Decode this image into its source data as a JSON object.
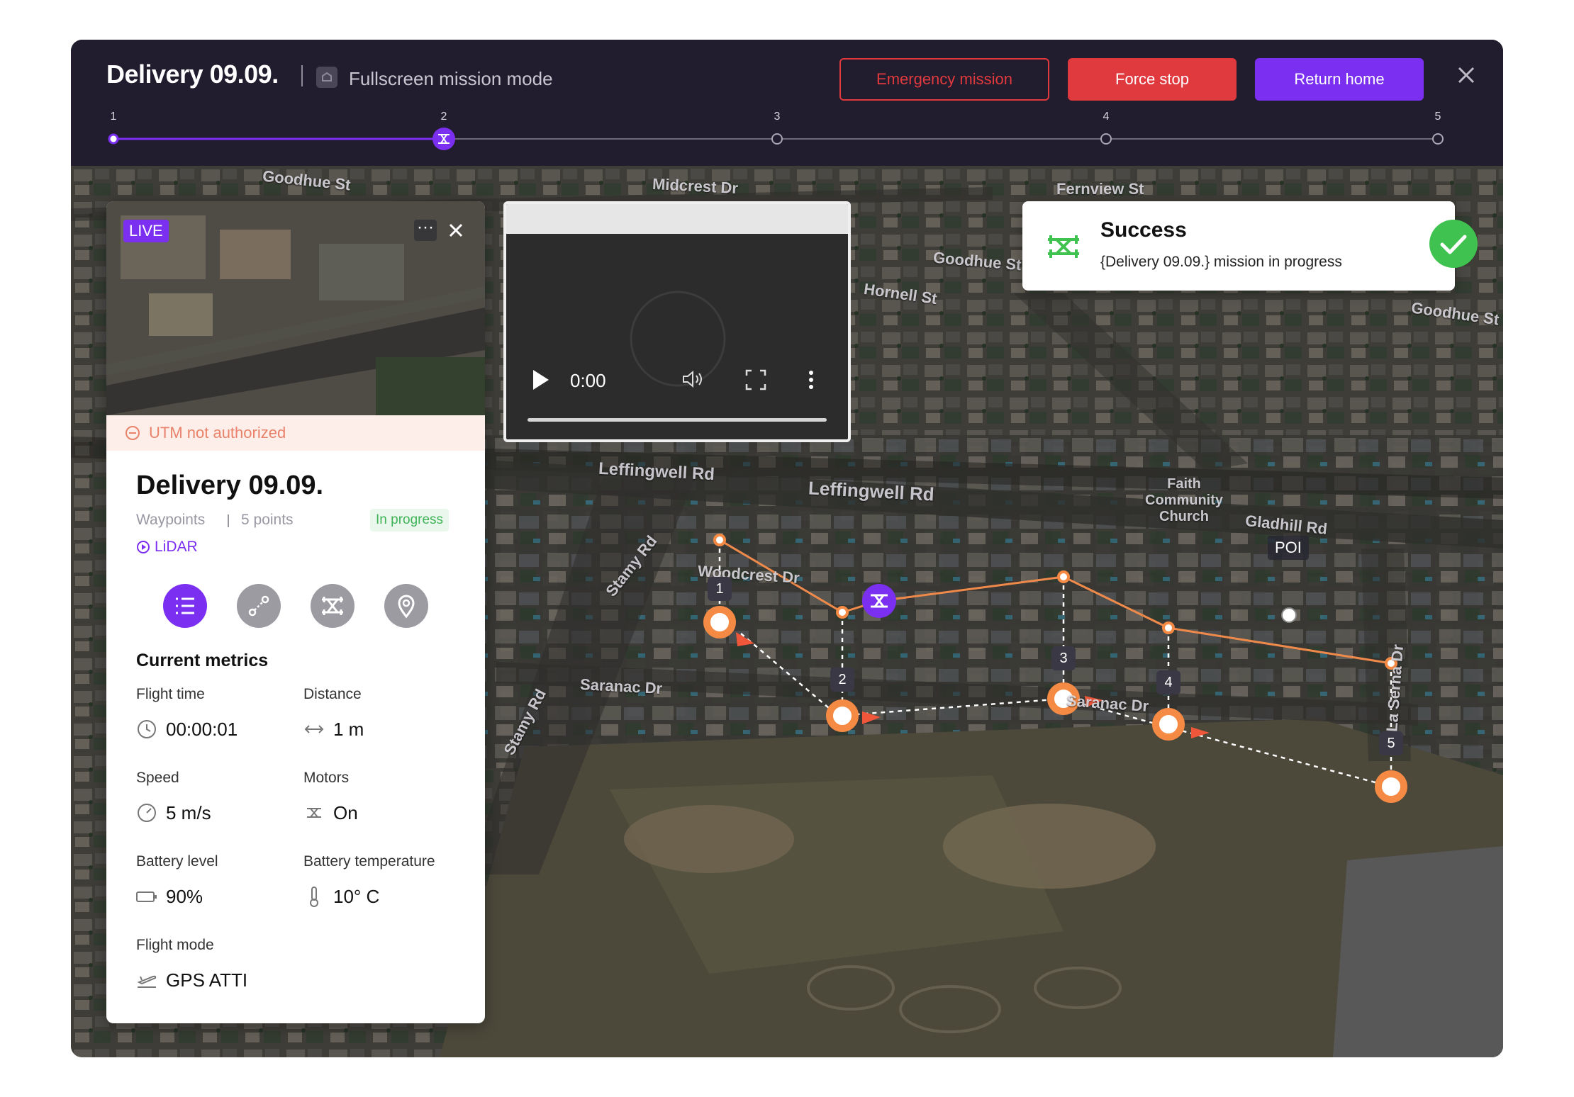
{
  "header": {
    "title": "Delivery 09.09.",
    "mode_label": "Fullscreen mission mode",
    "buttons": {
      "emergency": "Emergency mission",
      "force_stop": "Force stop",
      "return_home": "Return home"
    },
    "progress": {
      "steps": [
        "1",
        "2",
        "3",
        "4",
        "5"
      ],
      "current_step": 2
    }
  },
  "live_panel": {
    "badge": "LIVE",
    "utm_status": "UTM not authorized",
    "mission_title": "Delivery 09.09.",
    "waypoints_label": "Waypoints",
    "waypoints_count": "5 points",
    "status": "In progress",
    "sensor": "LiDAR",
    "toolbar_icons": [
      "list-icon",
      "route-icon",
      "drone-icon",
      "location-pin-icon"
    ],
    "metrics_title": "Current metrics",
    "metrics": {
      "flight_time": {
        "label": "Flight time",
        "value": "00:00:01"
      },
      "distance": {
        "label": "Distance",
        "value": "1 m"
      },
      "speed": {
        "label": "Speed",
        "value": "5 m/s"
      },
      "motors": {
        "label": "Motors",
        "value": "On"
      },
      "battery_level": {
        "label": "Battery level",
        "value": "90%"
      },
      "battery_temperature": {
        "label": "Battery temperature",
        "value": "10° C"
      },
      "flight_mode": {
        "label": "Flight mode",
        "value": "GPS ATTI"
      }
    }
  },
  "video": {
    "time": "0:00"
  },
  "toast": {
    "title": "Success",
    "message": "{Delivery 09.09.} mission in progress"
  },
  "map": {
    "street_labels": {
      "goodhue_st_1": "Goodhue St",
      "midcrest_dr": "Midcrest Dr",
      "fernview_st": "Fernview St",
      "goodhue_st_2": "Goodhue St",
      "hornell_st": "Hornell St",
      "goodhue_st_3": "Goodhue St",
      "leffingwell_rd_1": "Leffingwell Rd",
      "leffingwell_rd_2": "Leffingwell Rd",
      "faith_church": "Faith Community Church",
      "gladhill_rd": "Gladhill Rd",
      "stamy_rd": "Stamy Rd",
      "woodcrest_dr": "Woodcrest Dr",
      "saranac_dr_1": "Saranac Dr",
      "saranac_dr_2": "Saranac Dr",
      "la_serna_dr": "La Serna Dr",
      "stamy_rd_2": "Stamy Rd"
    },
    "poi_label": "POI",
    "waypoint_numbers": [
      "1",
      "2",
      "3",
      "4",
      "5"
    ],
    "colors": {
      "route": "#f08a4b",
      "waypoint": "#f58a45",
      "drone": "#7b2ff0",
      "accent": "#7b2ff0",
      "danger": "#e0393e",
      "success": "#3fc24f"
    }
  }
}
